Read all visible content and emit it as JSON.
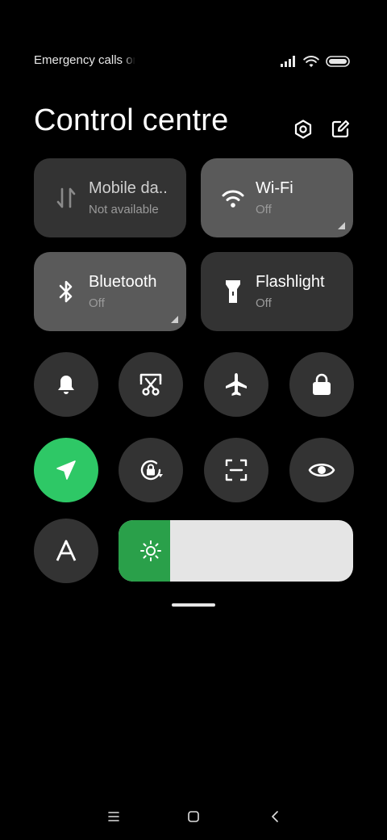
{
  "status_bar": {
    "carrier_text": "Emergency calls only",
    "icons": [
      "signal-icon",
      "wifi-icon",
      "battery-icon"
    ]
  },
  "header": {
    "title": "Control centre",
    "icons": [
      "settings-icon",
      "edit-icon"
    ]
  },
  "tiles": [
    {
      "label": "Mobile da..",
      "sub": "Not available",
      "icon": "mobile-data-icon",
      "state": "unavailable"
    },
    {
      "label": "Wi-Fi",
      "sub": "Off",
      "icon": "wifi-icon",
      "state": "off"
    },
    {
      "label": "Bluetooth",
      "sub": "Off",
      "icon": "bluetooth-icon",
      "state": "off"
    },
    {
      "label": "Flashlight",
      "sub": "Off",
      "icon": "flashlight-icon",
      "state": "off"
    }
  ],
  "toggles_row1": [
    "bell-icon",
    "screenshot-icon",
    "airplane-icon",
    "lock-icon"
  ],
  "toggles_row2": [
    "location-icon",
    "rotation-lock-icon",
    "scanner-icon",
    "eye-icon"
  ],
  "toggles_row3": [
    "auto-brightness-icon"
  ],
  "location_active": true,
  "brightness": {
    "level": 0.22,
    "icon": "sun-icon"
  },
  "colors": {
    "accent_green": "#2ec866",
    "brightness_green": "#2aa04a",
    "tile_off": "#333333",
    "tile_on": "#5a5a5a",
    "background": "#000000"
  },
  "nav_bar": {
    "icons": [
      "menu-icon",
      "home-icon",
      "back-icon"
    ]
  }
}
